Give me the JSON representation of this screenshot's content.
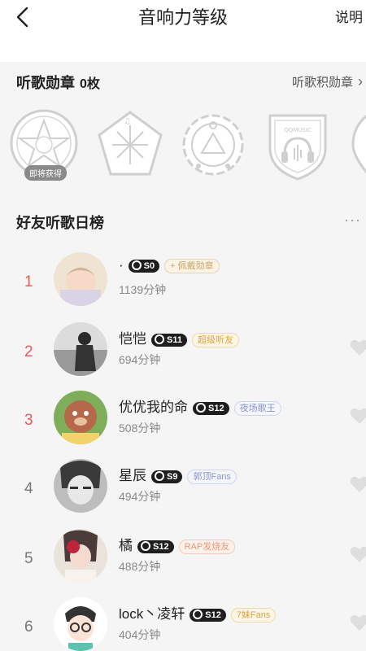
{
  "header": {
    "title": "音响力等级",
    "help_label": "说明"
  },
  "medals": {
    "heading": "听歌勋章",
    "count": "0枚",
    "link_label": "听歌积勋章",
    "soon_tag": "即将获得",
    "badges": [
      {
        "name": "star-badge-icon"
      },
      {
        "name": "arrows-badge-icon"
      },
      {
        "name": "paint-badge-icon"
      },
      {
        "name": "qqmusic-shield-badge-icon",
        "label": "QQMUSIC"
      },
      {
        "name": "partial-badge-icon"
      }
    ]
  },
  "ranking": {
    "heading": "好友听歌日榜",
    "more_label": "···",
    "rows": [
      {
        "rank": "1",
        "name": "·",
        "level": "S0",
        "tag": "+ 佩戴勋章",
        "tag_color": "#c9a76a",
        "minutes": "1139分钟"
      },
      {
        "rank": "2",
        "name": "恺恺",
        "level": "S11",
        "tag": "超级听友",
        "tag_color": "#d9a441",
        "minutes": "694分钟"
      },
      {
        "rank": "3",
        "name": "优优我的命",
        "level": "S12",
        "tag": "夜场歌王",
        "tag_color": "#8a96c8",
        "minutes": "508分钟"
      },
      {
        "rank": "4",
        "name": "星辰",
        "level": "S9",
        "tag": "郭顶Fans",
        "tag_color": "#8a96c8",
        "minutes": "494分钟"
      },
      {
        "rank": "5",
        "name": "橘",
        "level": "S12",
        "tag": "RAP发烧友",
        "tag_color": "#e69b7a",
        "minutes": "488分钟"
      },
      {
        "rank": "6",
        "name": "lock丶凌轩",
        "level": "S12",
        "tag": "7妹Fans",
        "tag_color": "#d9a441",
        "minutes": "404分钟"
      }
    ]
  },
  "colors": {
    "rank_red": "#e55a5a",
    "background": "#f5f5f5"
  }
}
